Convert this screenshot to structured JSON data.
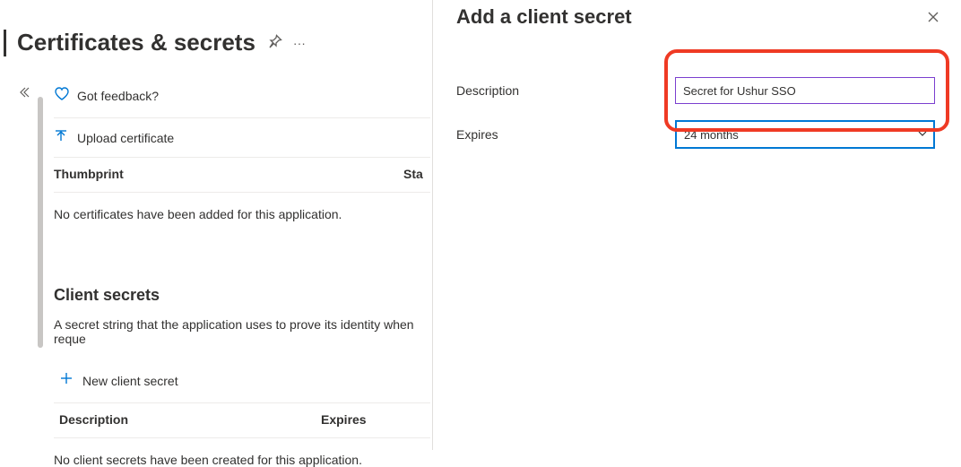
{
  "page": {
    "title": "Certificates & secrets",
    "feedback": "Got feedback?",
    "upload_certificate": "Upload certificate",
    "certificates_table": {
      "col_thumbprint": "Thumbprint",
      "col_status": "Sta"
    },
    "certificates_empty": "No certificates have been added for this application.",
    "secrets_section_title": "Client secrets",
    "secrets_section_desc": "A secret string that the application uses to prove its identity when reque",
    "new_secret": "New client secret",
    "secrets_table": {
      "col_description": "Description",
      "col_expires": "Expires"
    },
    "secrets_empty": "No client secrets have been created for this application."
  },
  "panel": {
    "title": "Add a client secret",
    "description_label": "Description",
    "description_value": "Secret for Ushur SSO",
    "expires_label": "Expires",
    "expires_value": "24 months"
  }
}
